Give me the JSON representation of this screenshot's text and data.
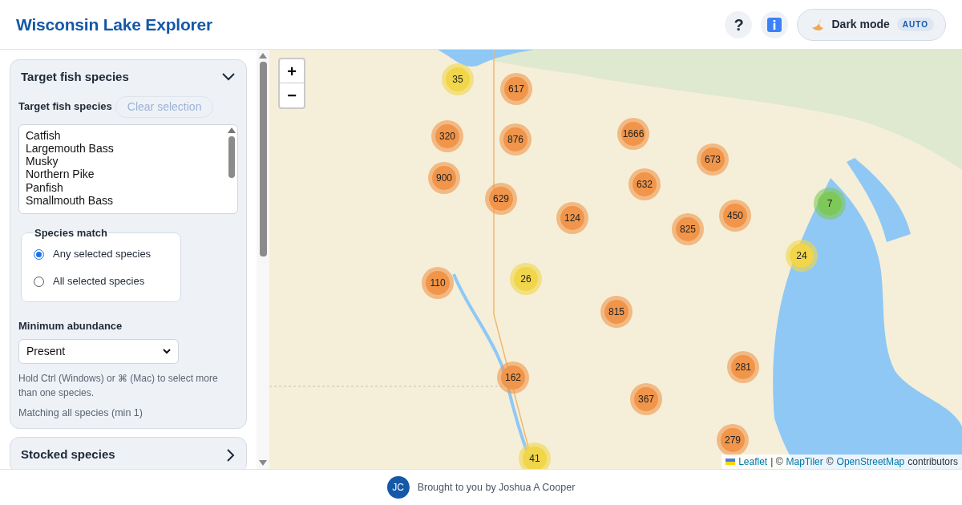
{
  "header": {
    "title": "Wisconsin Lake Explorer",
    "help": "?",
    "theme": {
      "label": "Dark mode",
      "badge": "AUTO"
    }
  },
  "sidebar": {
    "panels": [
      {
        "title": "Target fish species",
        "expanded": true,
        "field_label": "Target fish species",
        "clear_button": "Clear selection",
        "species": [
          {
            "label": "Catfish",
            "selected": false
          },
          {
            "label": "Largemouth Bass",
            "selected": false
          },
          {
            "label": "Musky",
            "selected": false
          },
          {
            "label": "Northern Pike",
            "selected": false
          },
          {
            "label": "Panfish",
            "selected": false
          },
          {
            "label": "Smallmouth Bass",
            "selected": false
          }
        ],
        "match": {
          "legend": "Species match",
          "options": [
            {
              "label": "Any selected species",
              "selected": true
            },
            {
              "label": "All selected species",
              "selected": false
            }
          ]
        },
        "abundance": {
          "label": "Minimum abundance",
          "value": "Present"
        },
        "hint": "Hold Ctrl (Windows) or ⌘ (Mac) to select more than one species.",
        "status": "Matching all species (min 1)"
      },
      {
        "title": "Stocked species",
        "expanded": false
      }
    ]
  },
  "map": {
    "zoom_in": "+",
    "zoom_out": "−",
    "clusters": [
      {
        "count": "35",
        "color": "#f1d54a"
      },
      {
        "count": "617",
        "color": "#f0954a"
      },
      {
        "count": "320",
        "color": "#f0954a"
      },
      {
        "count": "876",
        "color": "#f0954a"
      },
      {
        "count": "1666",
        "color": "#f0954a"
      },
      {
        "count": "673",
        "color": "#f0954a"
      },
      {
        "count": "900",
        "color": "#f0954a"
      },
      {
        "count": "632",
        "color": "#f0954a"
      },
      {
        "count": "629",
        "color": "#f0954a"
      },
      {
        "count": "124",
        "color": "#f0954a"
      },
      {
        "count": "450",
        "color": "#f0954a"
      },
      {
        "count": "825",
        "color": "#f0954a"
      },
      {
        "count": "7",
        "color": "#7ec85a"
      },
      {
        "count": "24",
        "color": "#f1d54a"
      },
      {
        "count": "110",
        "color": "#f0954a"
      },
      {
        "count": "26",
        "color": "#f1d54a"
      },
      {
        "count": "815",
        "color": "#f0954a"
      },
      {
        "count": "162",
        "color": "#f0954a"
      },
      {
        "count": "281",
        "color": "#f0954a"
      },
      {
        "count": "367",
        "color": "#f0954a"
      },
      {
        "count": "279",
        "color": "#f0954a"
      },
      {
        "count": "41",
        "color": "#f1d54a"
      }
    ],
    "attribution": {
      "leaflet": "Leaflet",
      "sep": "| ©",
      "maptiler": "MapTiler",
      "copy": "©",
      "osm": "OpenStreetMap",
      "tail": "contributors"
    }
  },
  "footer": {
    "initials": "JC",
    "text": "Brought to you by Joshua A Cooper"
  }
}
